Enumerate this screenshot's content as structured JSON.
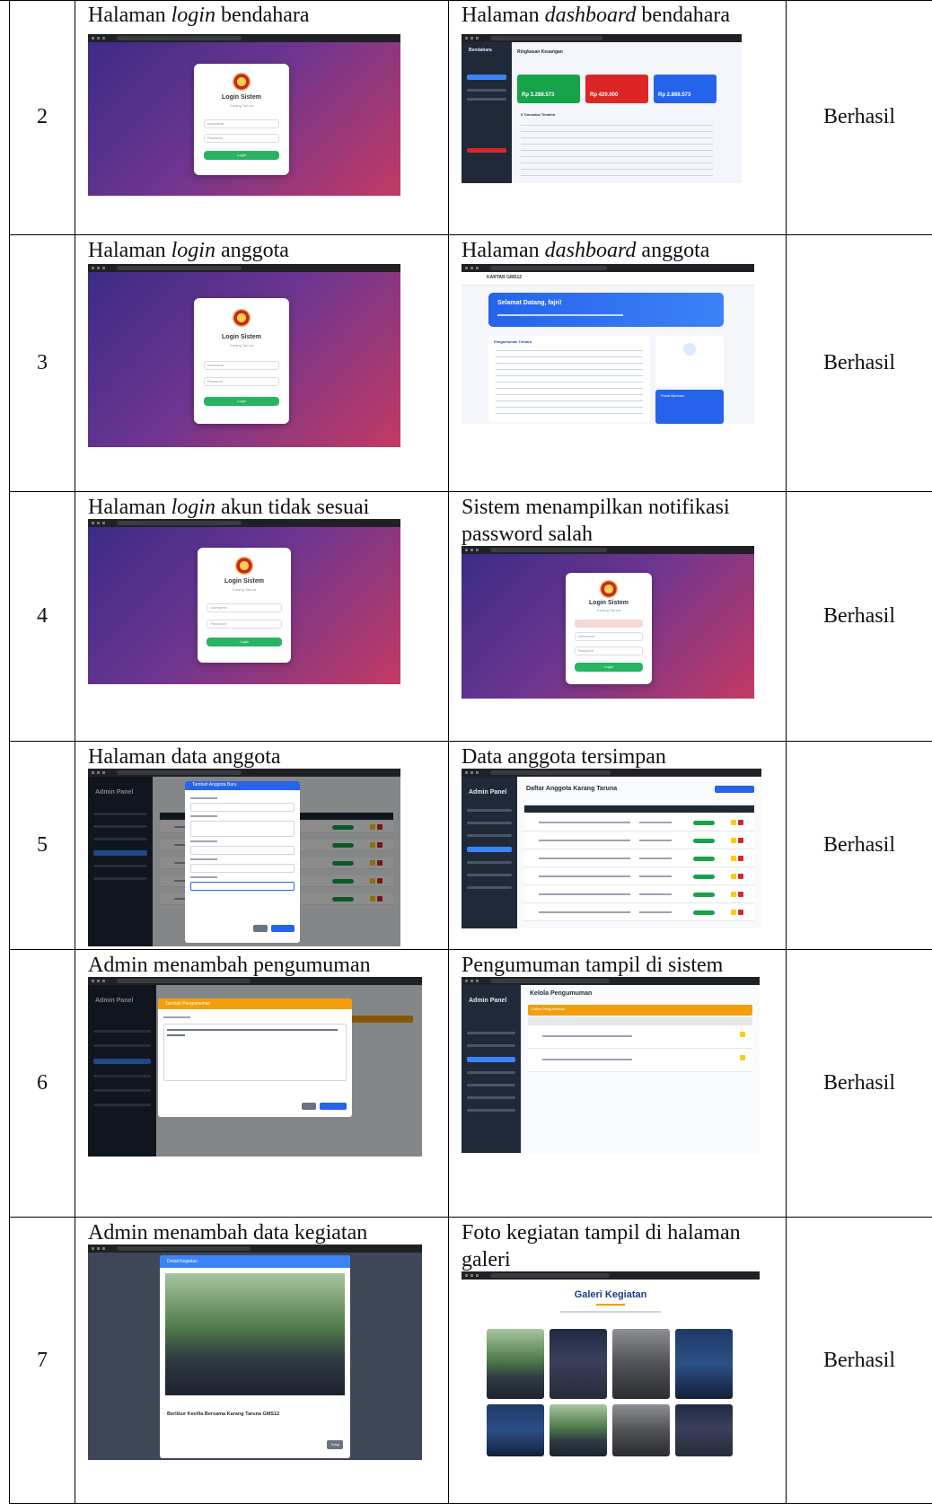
{
  "rows": [
    {
      "no": "2",
      "scenario": {
        "pre": "Halaman ",
        "em": "login",
        "post": " bendahara"
      },
      "expected": {
        "pre": "Halaman ",
        "em": "dashboard",
        "post": " bendahara"
      },
      "status": "Berhasil",
      "shot_left": {
        "card_title": "Login Sistem",
        "card_sub": "Karang Taruna",
        "field1": "Username",
        "field2": "Password",
        "button": "Login"
      },
      "shot_right": {
        "title": "Ringkasan Keuangan",
        "brand": "Bendahara",
        "cards": [
          "Rp 3.288.573",
          "Rp 420.000",
          "Rp 2.868.573"
        ],
        "table_title": "5 Transaksi Terakhir"
      }
    },
    {
      "no": "3",
      "scenario": {
        "pre": "Halaman ",
        "em": "login",
        "post": " anggota"
      },
      "expected": {
        "pre": "Halaman ",
        "em": "dashboard",
        "post": " anggota"
      },
      "status": "Berhasil",
      "shot_left": {
        "card_title": "Login Sistem",
        "card_sub": "Karang Taruna",
        "field1": "Username",
        "field2": "Password",
        "button": "Login"
      },
      "shot_right": {
        "brand": "KARTAR GMS12",
        "welcome": "Selamat Datang, fajri!",
        "announce": "Pengumuman Terbaru",
        "help": "Pusat Bantuan"
      }
    },
    {
      "no": "4",
      "scenario": {
        "pre": "Halaman ",
        "em": "login",
        "post": " akun tidak sesuai"
      },
      "expected": {
        "pre": "Sistem menampilkan notifikasi password salah",
        "em": "",
        "post": ""
      },
      "status": "Berhasil",
      "shot_left": {
        "card_title": "Login Sistem",
        "card_sub": "Karang Taruna",
        "field1": "Username",
        "field2": "Password",
        "button": "Login"
      },
      "shot_right": {
        "card_title": "Login Sistem",
        "card_sub": "Karang Taruna",
        "field1": "Username",
        "field2": "Password",
        "button": "Login"
      }
    },
    {
      "no": "5",
      "scenario": {
        "pre": "Halaman data anggota",
        "em": "",
        "post": ""
      },
      "expected": {
        "pre": "Data anggota tersimpan",
        "em": "",
        "post": ""
      },
      "status": "Berhasil",
      "shot_left": {
        "brand": "Admin Panel",
        "modal_title": "Tambah Anggota Baru"
      },
      "shot_right": {
        "brand": "Admin Panel",
        "title": "Daftar Anggota Karang Taruna"
      }
    },
    {
      "no": "6",
      "scenario": {
        "pre": "Admin menambah pengumuman",
        "em": "",
        "post": ""
      },
      "expected": {
        "pre": "Pengumuman tampil di sistem",
        "em": "",
        "post": ""
      },
      "status": "Berhasil",
      "shot_left": {
        "brand": "Admin Panel",
        "modal_title": "Tambah Pengumuman"
      },
      "shot_right": {
        "brand": "Admin Panel",
        "title": "Kelola Pengumuman",
        "subtitle": "Daftar Pengumuman"
      }
    },
    {
      "no": "7",
      "scenario": {
        "pre": "Admin menambah data kegiatan",
        "em": "",
        "post": ""
      },
      "expected": {
        "pre": "Foto kegiatan tampil di halaman galeri",
        "em": "",
        "post": ""
      },
      "status": "Berhasil",
      "shot_left": {
        "modal_title": "Detail Kegiatan",
        "caption": "Berlibur Kevilla Bersama Karang Taruna GMS12",
        "button": "Tutup"
      },
      "shot_right": {
        "title": "Galeri Kegiatan"
      }
    }
  ],
  "colors": {
    "login_gradient": [
      "#3b2b85",
      "#c33a63"
    ],
    "green": "#28b463",
    "blue": "#2563eb",
    "sidebar": "#1f2937"
  }
}
